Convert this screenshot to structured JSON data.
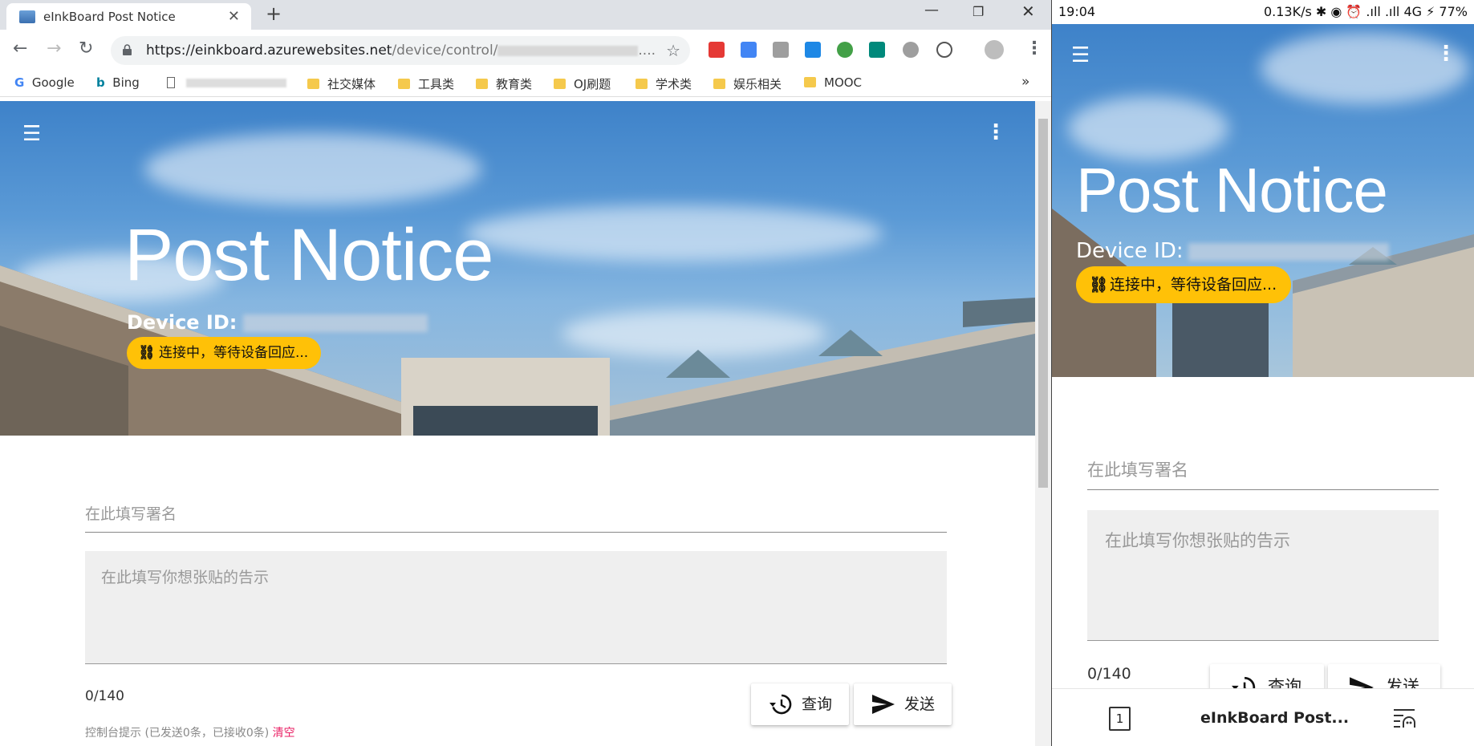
{
  "browser": {
    "tab_title": "eInkBoard Post Notice",
    "tab_close": "✕",
    "new_tab": "+",
    "url_host": "https://einkboard.azurewebsites.net",
    "url_path": "/device/control/",
    "url_ellipsis": "....",
    "bookmarks": [
      "Google",
      "Bing",
      "社交媒体",
      "工具类",
      "教育类",
      "OJ刷题",
      "学术类",
      "娱乐相关",
      "MOOC"
    ],
    "bookmarks_overflow": "»"
  },
  "page": {
    "hero_title": "Post Notice",
    "device_id_label": "Device ID:",
    "status_chip": "连接中，等待设备回应...",
    "signature_placeholder": "在此填写署名",
    "notice_placeholder": "在此填写你想张贴的告示",
    "counter": "0/140",
    "query_button": "查询",
    "send_button": "发送",
    "console_text": "控制台提示 (已发送0条，已接收0条)",
    "console_clear": "清空"
  },
  "phone": {
    "time": "19:04",
    "status_right": "0.13K/s ✱ ◉ ⏰ .ıll .ıll 4G ⚡ 77%",
    "hero_title": "Post Notice",
    "device_id_label": "Device ID:",
    "status_chip": "连接中，等待设备回应...",
    "signature_placeholder": "在此填写署名",
    "notice_placeholder": "在此填写你想张贴的告示",
    "counter": "0/140",
    "query_button": "查询",
    "send_button": "发送",
    "tab_count": "1",
    "bottom_title": "eInkBoard Post..."
  },
  "colors": {
    "chip_yellow": "#ffc107",
    "clear_pink": "#e91e63",
    "sky_blue": "#3e82c9"
  }
}
